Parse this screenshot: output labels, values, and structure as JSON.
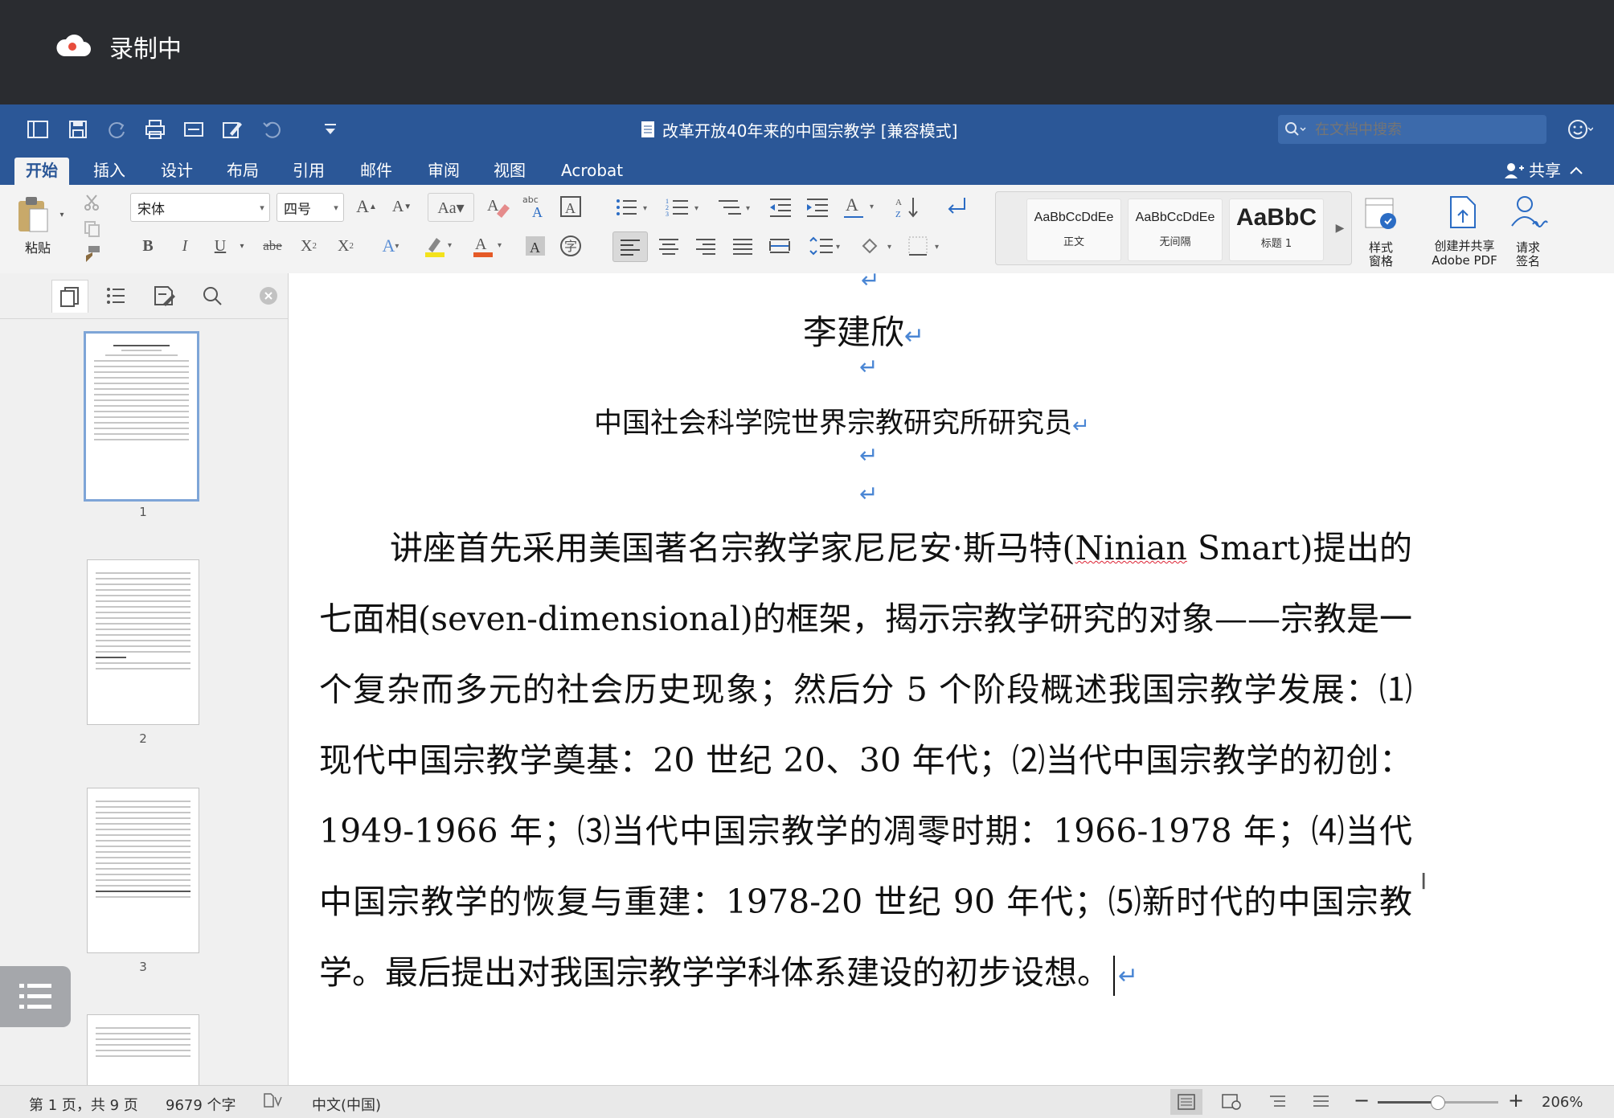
{
  "recording": {
    "label": "录制中"
  },
  "window": {
    "title": "改革开放40年来的中国宗教学 [兼容模式]",
    "search_placeholder": "在文档中搜索"
  },
  "tabs": [
    {
      "label": "开始",
      "active": true
    },
    {
      "label": "插入"
    },
    {
      "label": "设计"
    },
    {
      "label": "布局"
    },
    {
      "label": "引用"
    },
    {
      "label": "邮件"
    },
    {
      "label": "审阅"
    },
    {
      "label": "视图"
    },
    {
      "label": "Acrobat"
    }
  ],
  "share_label": "共享",
  "ribbon": {
    "paste_label": "粘贴",
    "font_name": "宋体",
    "font_size": "四号",
    "styles": [
      {
        "preview": "AaBbCcDdEe",
        "name": "正文"
      },
      {
        "preview": "AaBbCcDdEe",
        "name": "无间隔"
      },
      {
        "preview": "AaBbC",
        "name": "标题 1"
      }
    ],
    "styles_pane_label": "样式\n窗格",
    "adobe_label_1": "创建并共享",
    "adobe_label_2": "Adobe PDF",
    "sign_label": "请求\n签名"
  },
  "sidebar": {
    "pages": [
      "1",
      "2",
      "3"
    ]
  },
  "document": {
    "author": "李建欣",
    "affiliation": "中国社会科学院世界宗教研究所研究员",
    "para_part1": "讲座首先采用美国著名宗教学家尼尼安·斯马特(",
    "para_squiggle": "Ninian",
    "para_part2": " Smart)提出的七面相(seven-dimensional)的框架，揭示宗教学研究的对象——宗教是一个复杂而多元的社会历史现象；然后分 5 个阶段概述我国宗教学发展：⑴现代中国宗教学奠基：20 世纪 20、30 年代；⑵当代中国宗教学的初创：1949-1966 年；⑶当代中国宗教学的凋零时期：1966-1978 年；⑷当代中国宗教学的恢复与重建：1978-20 世纪 90 年代；⑸新时代的中国宗教学。最后提出对我国宗教学学科体系建设的初步设想。"
  },
  "status": {
    "page": "第 1 页，共 9 页",
    "words": "9679 个字",
    "language": "中文(中国)",
    "zoom": "206%",
    "zoom_fraction": 0.49
  },
  "colors": {
    "title_bar": "#2b5797",
    "formatting_mark": "#4a86d4"
  }
}
